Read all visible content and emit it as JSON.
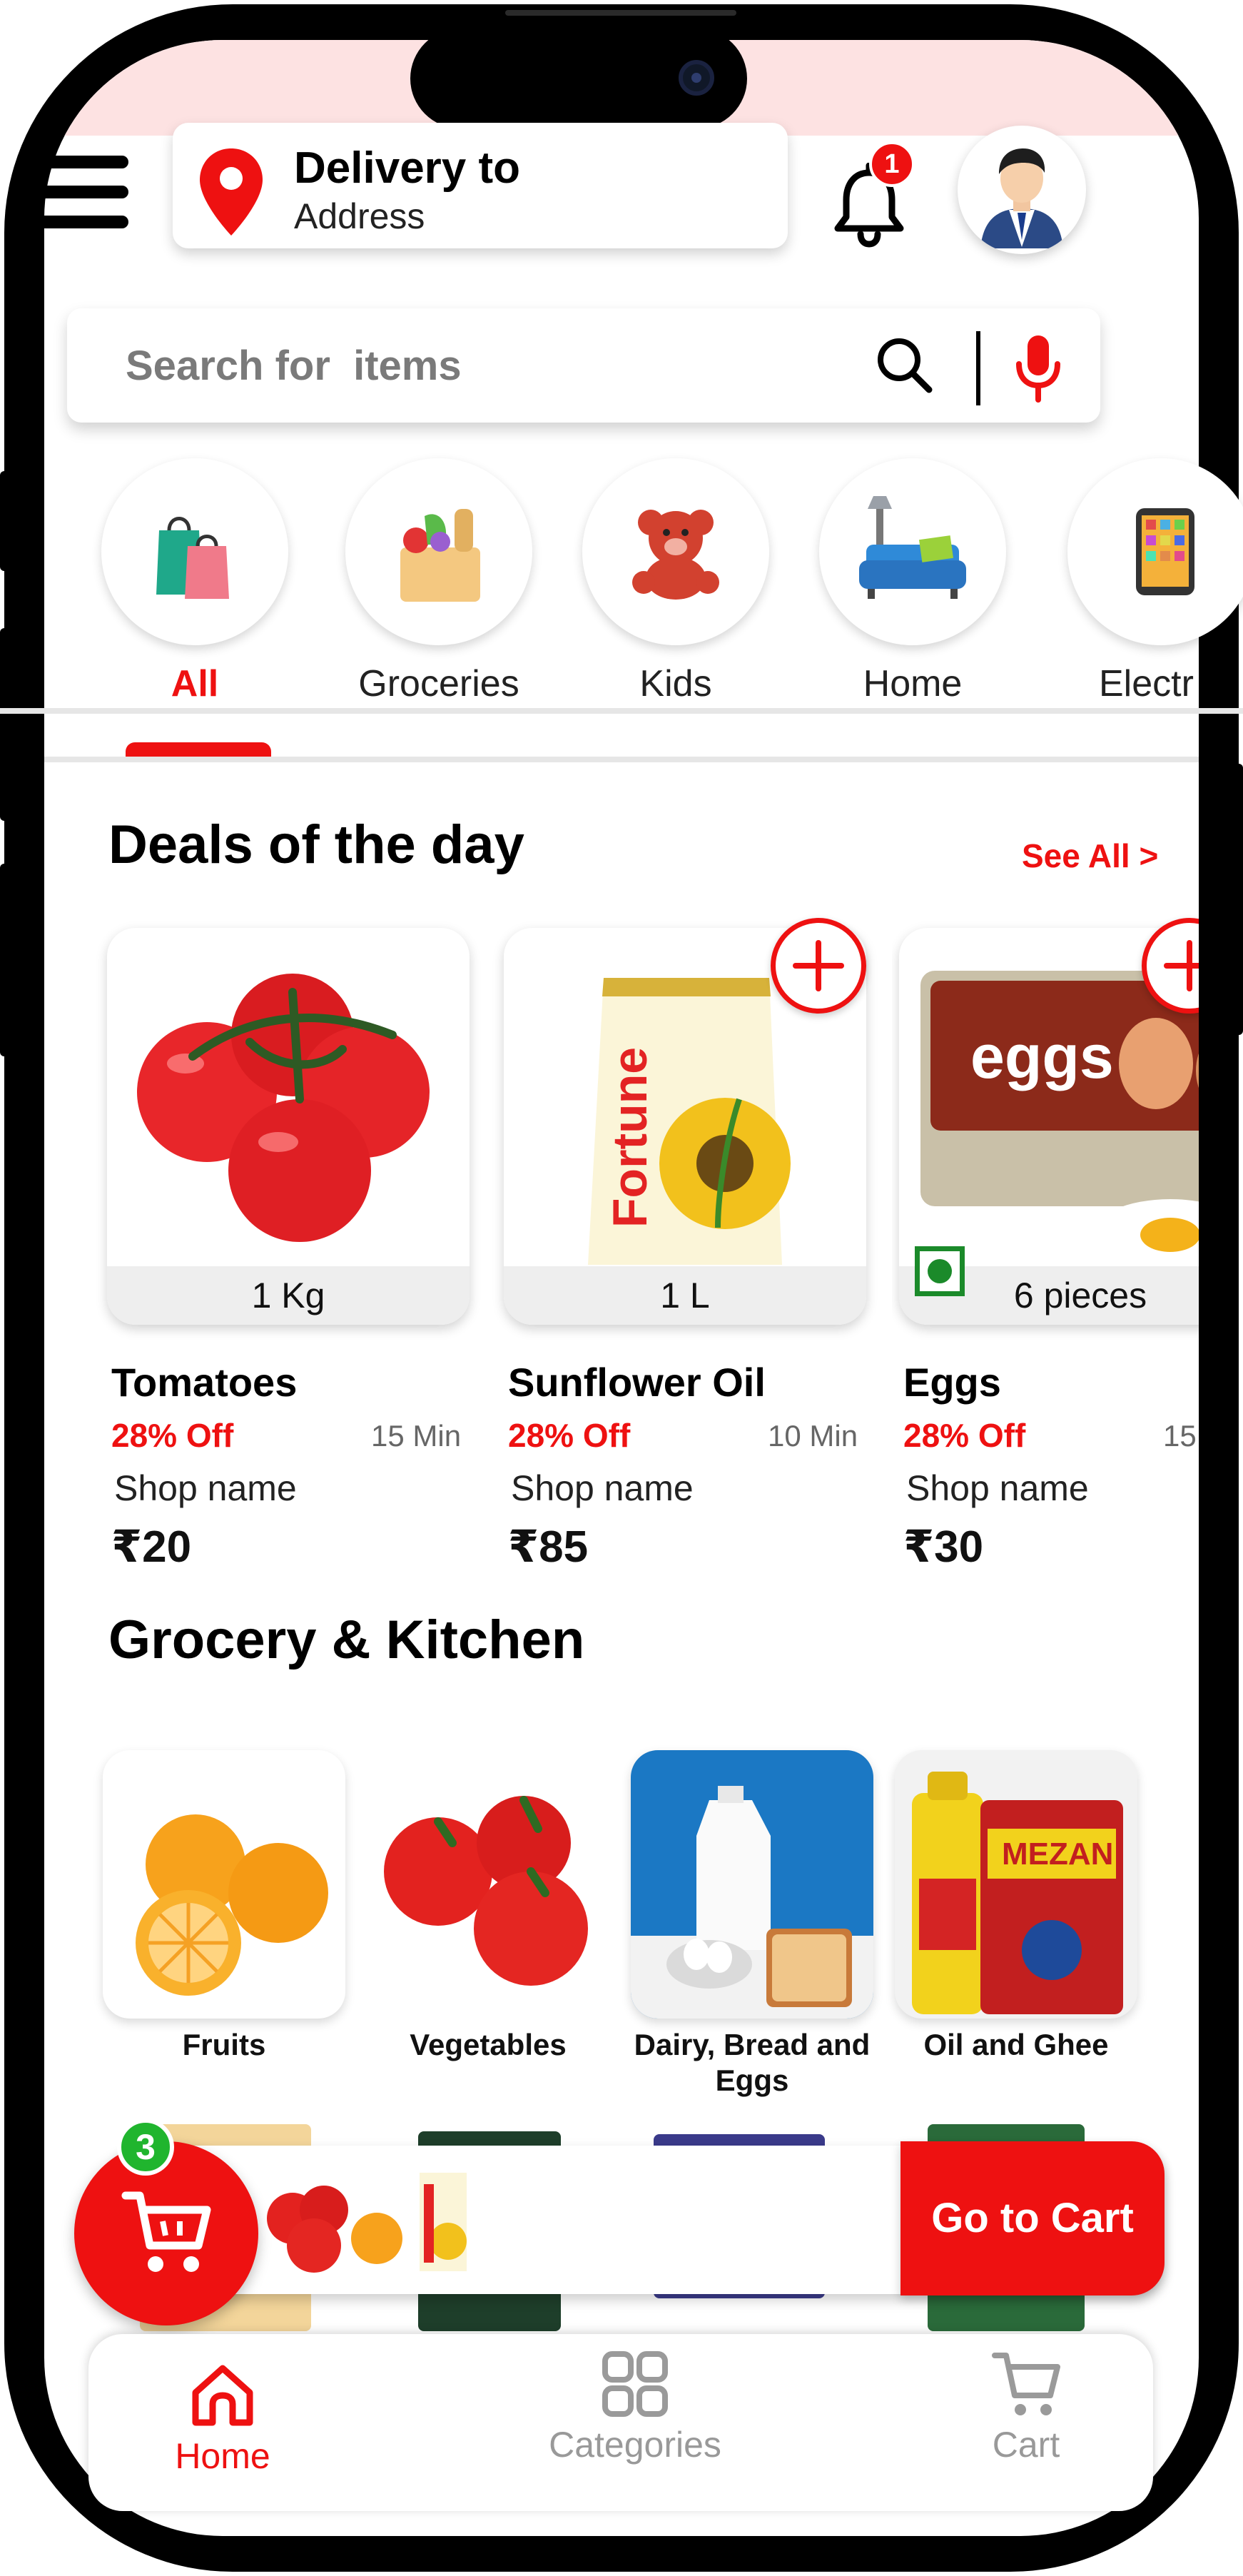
{
  "header": {
    "delivery_title": "Delivery to",
    "delivery_address": "Address",
    "notification_count": "1"
  },
  "search": {
    "placeholder": "Search for  items"
  },
  "categories": {
    "items": [
      {
        "label": "All",
        "icon": "shopping-bags-icon",
        "active": true
      },
      {
        "label": "Groceries",
        "icon": "grocery-bag-icon"
      },
      {
        "label": "Kids",
        "icon": "teddy-bear-icon"
      },
      {
        "label": "Home",
        "icon": "sofa-icon"
      },
      {
        "label": "Electr",
        "icon": "phone-icon"
      }
    ]
  },
  "deals": {
    "title": "Deals of the day",
    "see_all": "See All  >",
    "items": [
      {
        "name": "Tomatoes",
        "quantity": "1 Kg",
        "discount": "28% Off",
        "time": "15 Min",
        "shop": "Shop name",
        "price": "20"
      },
      {
        "name": "Sunflower Oil",
        "quantity": "1 L",
        "discount": "28% Off",
        "time": "10 Min",
        "shop": "Shop name",
        "price": "85"
      },
      {
        "name": "Eggs",
        "quantity": "6 pieces",
        "discount": "28% Off",
        "time": "15",
        "shop": "Shop name",
        "price": "30"
      }
    ],
    "currency_symbol": "₹"
  },
  "grocery_kitchen": {
    "title": "Grocery & Kitchen",
    "items": [
      {
        "label": "Fruits"
      },
      {
        "label": "Vegetables"
      },
      {
        "label": "Dairy, Bread and Eggs"
      },
      {
        "label": "Oil and Ghee"
      }
    ]
  },
  "cart": {
    "count": "3",
    "button_label": "Go to Cart"
  },
  "bottom_nav": {
    "items": [
      {
        "label": "Home",
        "active": true
      },
      {
        "label": "Categories"
      },
      {
        "label": "Cart"
      }
    ]
  },
  "colors": {
    "accent": "#ee1111",
    "veg_green": "#1b8a2a",
    "badge_green": "#20b52e",
    "status_pink": "#fde2e2"
  }
}
